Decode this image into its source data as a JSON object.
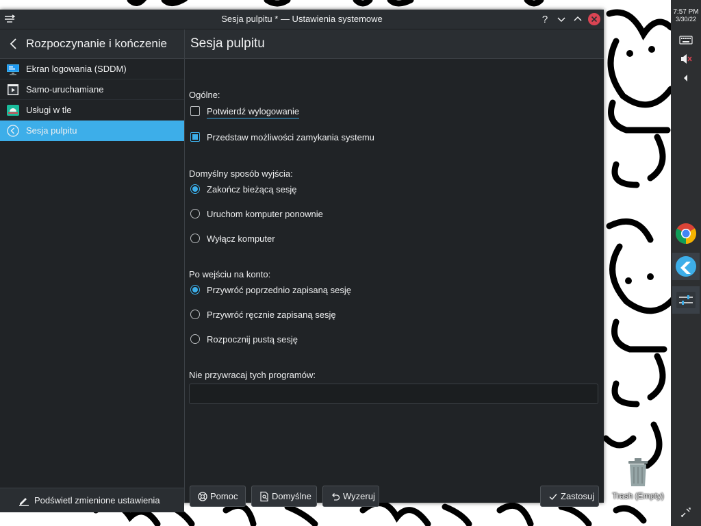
{
  "window": {
    "title": "Sesja pulpitu * — Ustawienia systemowe"
  },
  "sidebar": {
    "title": "Rozpoczynanie i kończenie",
    "items": [
      {
        "label": "Ekran logowania (SDDM)",
        "icon": "monitor-login-icon"
      },
      {
        "label": "Samo-uruchamiane",
        "icon": "autostart-icon"
      },
      {
        "label": "Usługi w tle",
        "icon": "background-services-icon"
      },
      {
        "label": "Sesja pulpitu",
        "icon": "desktop-session-icon",
        "active": true
      }
    ],
    "highlight_label": "Podświetl zmienione ustawienia"
  },
  "main": {
    "title": "Sesja pulpitu",
    "general_label": "Ogólne:",
    "confirm_logout": {
      "label": "Potwierdź wylogowanie",
      "checked": false
    },
    "offer_shutdown": {
      "label": "Przedstaw możliwości zamykania systemu",
      "checked": true
    },
    "default_exit_label": "Domyślny sposób wyjścia:",
    "exit_options": [
      {
        "label": "Zakończ bieżącą sesję",
        "checked": true
      },
      {
        "label": "Uruchom komputer ponownie",
        "checked": false
      },
      {
        "label": "Wyłącz komputer",
        "checked": false
      }
    ],
    "login_label": "Po wejściu na konto:",
    "login_options": [
      {
        "label": "Przywróć poprzednio zapisaną sesję",
        "checked": true
      },
      {
        "label": "Przywróć ręcznie zapisaną sesję",
        "checked": false
      },
      {
        "label": "Rozpocznij pustą sesję",
        "checked": false
      }
    ],
    "exclude_label": "Nie przywracaj tych programów:",
    "exclude_value": ""
  },
  "footer": {
    "help": "Pomoc",
    "defaults": "Domyślne",
    "reset": "Wyzeruj",
    "apply": "Zastosuj"
  },
  "panel": {
    "time": "7:57 PM",
    "date": "3/30/22"
  },
  "desktop": {
    "trash_label": "Trash (Empty)"
  },
  "colors": {
    "accent": "#3daee9",
    "window_bg": "#202326",
    "header_bg": "#2a2e32",
    "close_button": "#da4453"
  }
}
